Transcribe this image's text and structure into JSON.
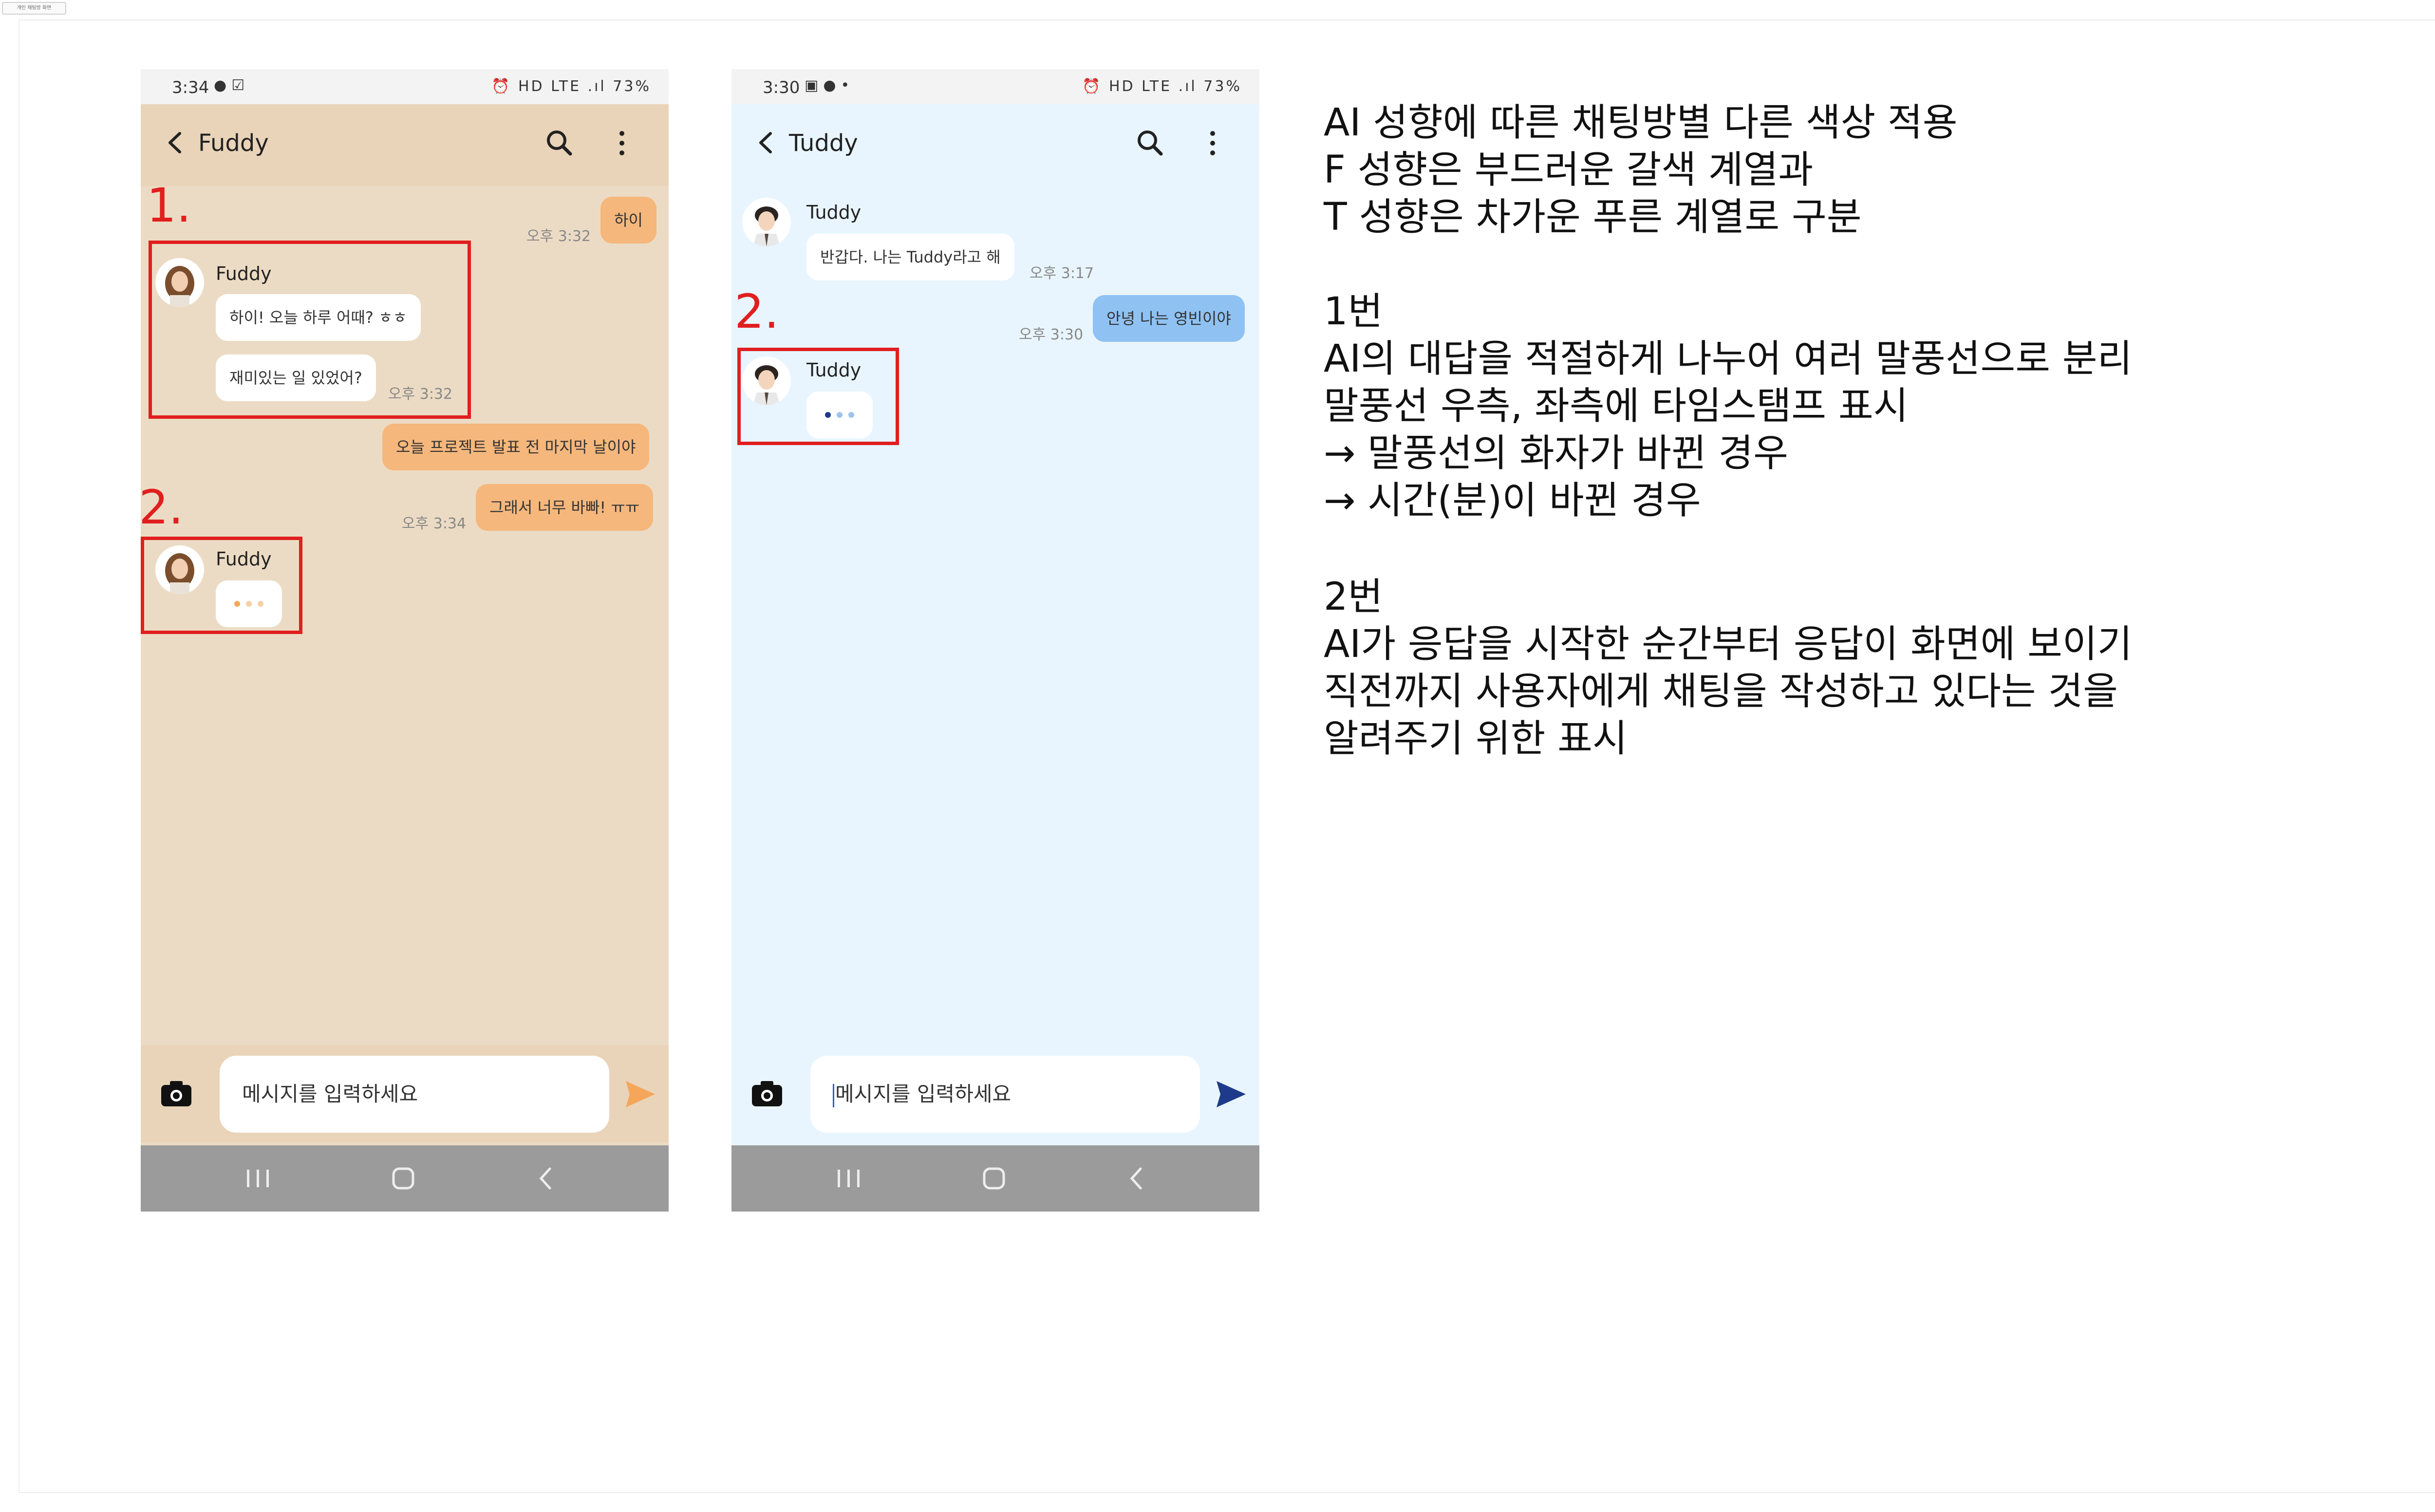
{
  "doc_tab_label": "개인 채팅방 화면",
  "colors": {
    "fuddy_bg": "#ecdbc4",
    "fuddy_bubble": "#f5b77c",
    "tuddy_bg": "#e8f5ff",
    "tuddy_bubble": "#8fc2f3",
    "highlight": "#e01f1f"
  },
  "phone_f": {
    "status": {
      "time": "3:34",
      "left_icons": "message-icon,check-icon",
      "right": "HD LTE .ıl 73%"
    },
    "header": {
      "title": "Fuddy"
    },
    "messages": {
      "m1": {
        "text": "하이",
        "time": "오후 3:32"
      },
      "m2": {
        "sender": "Fuddy",
        "text": "하이! 오늘 하루 어때? ㅎㅎ"
      },
      "m3": {
        "text": "재미있는 일 있었어?",
        "time": "오후 3:32"
      },
      "m4": {
        "text": "오늘 프로젝트 발표 전 마지막 날이야"
      },
      "m5": {
        "text": "그래서 너무 바빠! ㅠㅠ",
        "time": "오후 3:34"
      },
      "typing_sender": "Fuddy"
    },
    "annotations": {
      "n1": "1.",
      "n2": "2."
    },
    "input_placeholder": "메시지를 입력하세요"
  },
  "phone_t": {
    "status": {
      "time": "3:30",
      "left_icons": "image-icon,info-icon",
      "right": "HD LTE .ıl 73%"
    },
    "header": {
      "title": "Tuddy"
    },
    "messages": {
      "m1": {
        "sender": "Tuddy",
        "text": "반갑다. 나는 Tuddy라고 해",
        "time": "오후 3:17"
      },
      "m2": {
        "text": "안녕 나는 영빈이야",
        "time": "오후 3:30"
      },
      "typing_sender": "Tuddy"
    },
    "annotations": {
      "n2": "2."
    },
    "input_placeholder": "메시지를 입력하세요"
  },
  "notes": {
    "l1": "AI 성향에 따른 채팅방별 다른 색상 적용",
    "l2": "F 성향은 부드러운 갈색 계열과",
    "l3": "T 성향은 차가운 푸른 계열로 구분",
    "s1_title": "1번",
    "s1_l1": "AI의 대답을 적절하게 나누어 여러 말풍선으로 분리",
    "s1_l2": "말풍선 우측, 좌측에 타임스탬프 표시",
    "s1_l3": "→ 말풍선의 화자가 바뀐 경우",
    "s1_l4": "→ 시간(분)이 바뀐 경우",
    "s2_title": "2번",
    "s2_l1": "AI가 응답을 시작한 순간부터 응답이 화면에 보이기",
    "s2_l2": "직전까지 사용자에게 채팅을 작성하고 있다는 것을",
    "s2_l3": "알려주기 위한 표시"
  }
}
